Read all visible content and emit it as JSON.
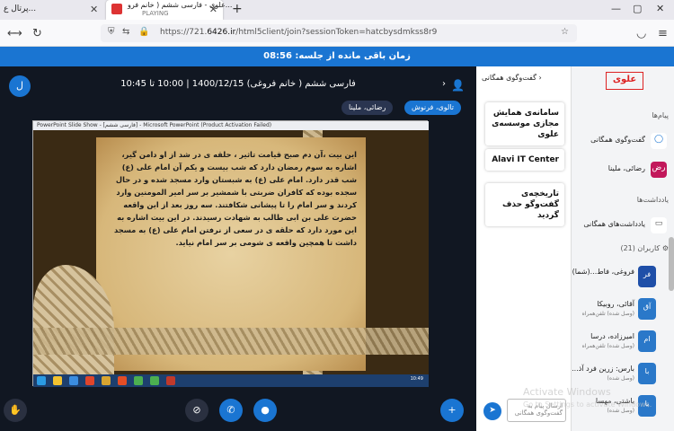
{
  "browser": {
    "prev_tab_label": "پرتال ع...",
    "active_tab_title": "علوی - فارسی ششم ( خانم فرو...",
    "active_tab_subtitle": "PLAYING",
    "new_tab": "+",
    "url_prefix": "https://721.",
    "url_host": "6426.ir",
    "url_rest": "/html5client/join?sessionToken=hatcbysdmkss8r9"
  },
  "timer_bar": {
    "text": "زمان باقی مانده از جلسه: 08:56"
  },
  "session": {
    "title": "فارسی ششم ( خانم فروغی) 1400/12/15 | 10:00 تا 10:45",
    "presenters": [
      "تالوی، فرنوش",
      "رضائی، ملینا"
    ]
  },
  "slide": {
    "caption": "PowerPoint Slide Show - [فارسی ششم] - Microsoft PowerPoint (Product Activation Failed)",
    "text": "این بیت ،آن دم صبح قیامت تاثیر ، حلقه ی در شد از او دامن گیر، اشاره به سوم رمضان دارد که شب بیست و یکم آن امام علی (ع) شب قدر دارد. امام علی (ع) به شبستان وارد مسجد شده و در حال سجده بوده که کافران ضربتی با شمشیر بر سر امیر المومنین وارد کردند و سر امام را تا پیشانی شکافتند. سه روز بعد از این واقعه حضرت علی بن ابی طالب به شهادت رسیدند. در این بیت اشاره به این مورد دارد که حلقه ی در سعی از نرفتن امام علی (ع) به مسجد داشت تا همچین واقعه ی شومی بر سر امام نیاید.",
    "clock": "10:49"
  },
  "chat": {
    "header": "گفت‌وگوی همگانی",
    "cards": [
      "سامانه‌ی همایش مجازی موسسه‌ی علوی",
      "Alavi IT Center",
      "تاریخچه‌ی گفت‌وگو حذف گردید"
    ],
    "input_placeholder": "ارسال پیام به گفت‌وگوی همگانی"
  },
  "sidebar": {
    "brand": "علوی",
    "messages_heading": "پیام‌ها",
    "public_chat_label": "گفت‌وگوی همگانی",
    "user_chat_label": "رضائی، ملینا",
    "user_chat_avatar": "رض",
    "notes_heading": "یادداشت‌ها",
    "shared_notes_label": "یادداشت‌های همگانی",
    "users_heading": "کاربران (21)",
    "users": [
      {
        "avatar": "فر",
        "name": "فروغی، فاط...(شما)",
        "status": "",
        "color": "#1f4fa8"
      },
      {
        "avatar": "آق",
        "name": "آقائی، روبیکا",
        "status": "(وصل شده) تلفن‌همراه",
        "color": "#2a78c9"
      },
      {
        "avatar": "ام",
        "name": "امیرزاده، درسا",
        "status": "(وصل شده) تلفن‌همراه",
        "color": "#2a78c9"
      },
      {
        "avatar": "با",
        "name": "بارس: زرین فرد آذ...",
        "status": "(وصل شده)",
        "color": "#2a78c9"
      },
      {
        "avatar": "با",
        "name": "باشتی، مهسا",
        "status": "(وصل شده)",
        "color": "#2a78c9"
      }
    ]
  },
  "watermark": {
    "line1": "Activate Windows",
    "line2": "Go to Settings to activate Windows."
  },
  "colors": {
    "accent": "#1a75d2",
    "brand_red": "#d22222",
    "main_bg": "#111722"
  }
}
